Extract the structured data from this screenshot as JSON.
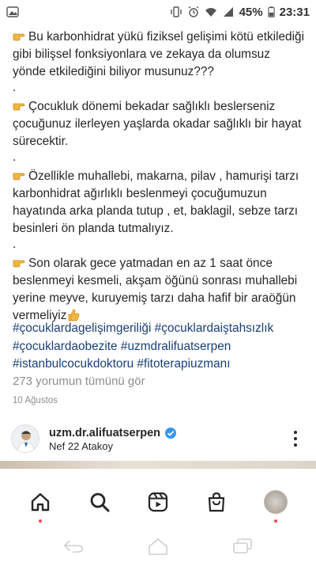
{
  "status_bar": {
    "battery": "45%",
    "time": "23:31"
  },
  "caption": {
    "p1": "Bu karbonhidrat yükü fiziksel gelişimi kötü etkilediği gibi bilişsel fonksiyonlara ve zekaya da olumsuz yönde etkilediğini biliyor musunuz???",
    "p2": "Çocukluk dönemi bekadar sağlıklı beslerseniz çocuğunuz ilerleyen yaşlarda okadar sağlıklı bir hayat sürecektir.",
    "p3": "Özellikle muhallebi, makarna, pilav , hamurişi tarzı karbonhidrat ağırlıklı beslenmeyi çocuğumuzun hayatında arka planda tutup , et, baklagil, sebze tarzı besinleri ön planda tutmalıyız.",
    "p4": "Son olarak gece yatmadan en az 1 saat önce beslenmeyi kesmeli, akşam öğünü sonrası muhallebi yerine meyve, kuruyemiş tarzı daha hafif bir araöğün vermeliyiz",
    "dot": "."
  },
  "hashtags": {
    "line1": "#çocuklardagelişimgeriliği #çocuklardaiştahsızlık",
    "line2": "#çocuklardaobezite #uzmdralifuatserpen",
    "line3": "#istanbulcocukdoktoru #fitoterapiuzmanı"
  },
  "comments_link": "273 yorumun tümünü gör",
  "post_date": "10 Ağustos",
  "next_post": {
    "username": "uzm.dr.alifuatserpen",
    "location": "Nef 22 Atakoy"
  },
  "icons": {
    "pointing": "backhand-index-pointing-right-icon",
    "thumbs": "thumbs-up-icon",
    "verified": "verified-badge-icon",
    "home": "home-icon",
    "search": "search-icon",
    "reels": "reels-icon",
    "shop": "shop-icon",
    "profile": "profile-avatar",
    "back": "back-icon",
    "android_home": "android-home-icon",
    "recents": "recents-icon"
  },
  "colors": {
    "hashtag": "#1a3f78",
    "secondary_text": "#8e8e8e",
    "verified": "#3897f0",
    "notification_dot": "#ed4956"
  }
}
